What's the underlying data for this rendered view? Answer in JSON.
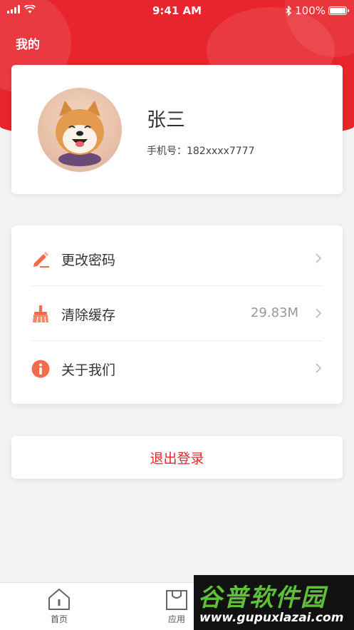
{
  "status_bar": {
    "time": "9:41 AM",
    "battery": "100%"
  },
  "header": {
    "title": "我的"
  },
  "profile": {
    "name": "张三",
    "phone_label": "手机号：",
    "phone_value": "182xxxx7777"
  },
  "menu": {
    "items": [
      {
        "label": "更改密码",
        "value": "",
        "icon": "edit-pencil-icon"
      },
      {
        "label": "清除缓存",
        "value": "29.83M",
        "icon": "broom-icon"
      },
      {
        "label": "关于我们",
        "value": "",
        "icon": "info-icon"
      }
    ]
  },
  "logout": {
    "label": "退出登录"
  },
  "tabbar": {
    "tabs": [
      {
        "label": "首页",
        "icon": "home-icon"
      },
      {
        "label": "应用",
        "icon": "bag-icon"
      }
    ]
  },
  "watermark": {
    "title": "谷普软件园",
    "url": "www.gupuxlazai.com"
  },
  "colors": {
    "primary_red": "#e8242c",
    "icon_orange": "#f26b4b",
    "background": "#f3f3f3"
  }
}
